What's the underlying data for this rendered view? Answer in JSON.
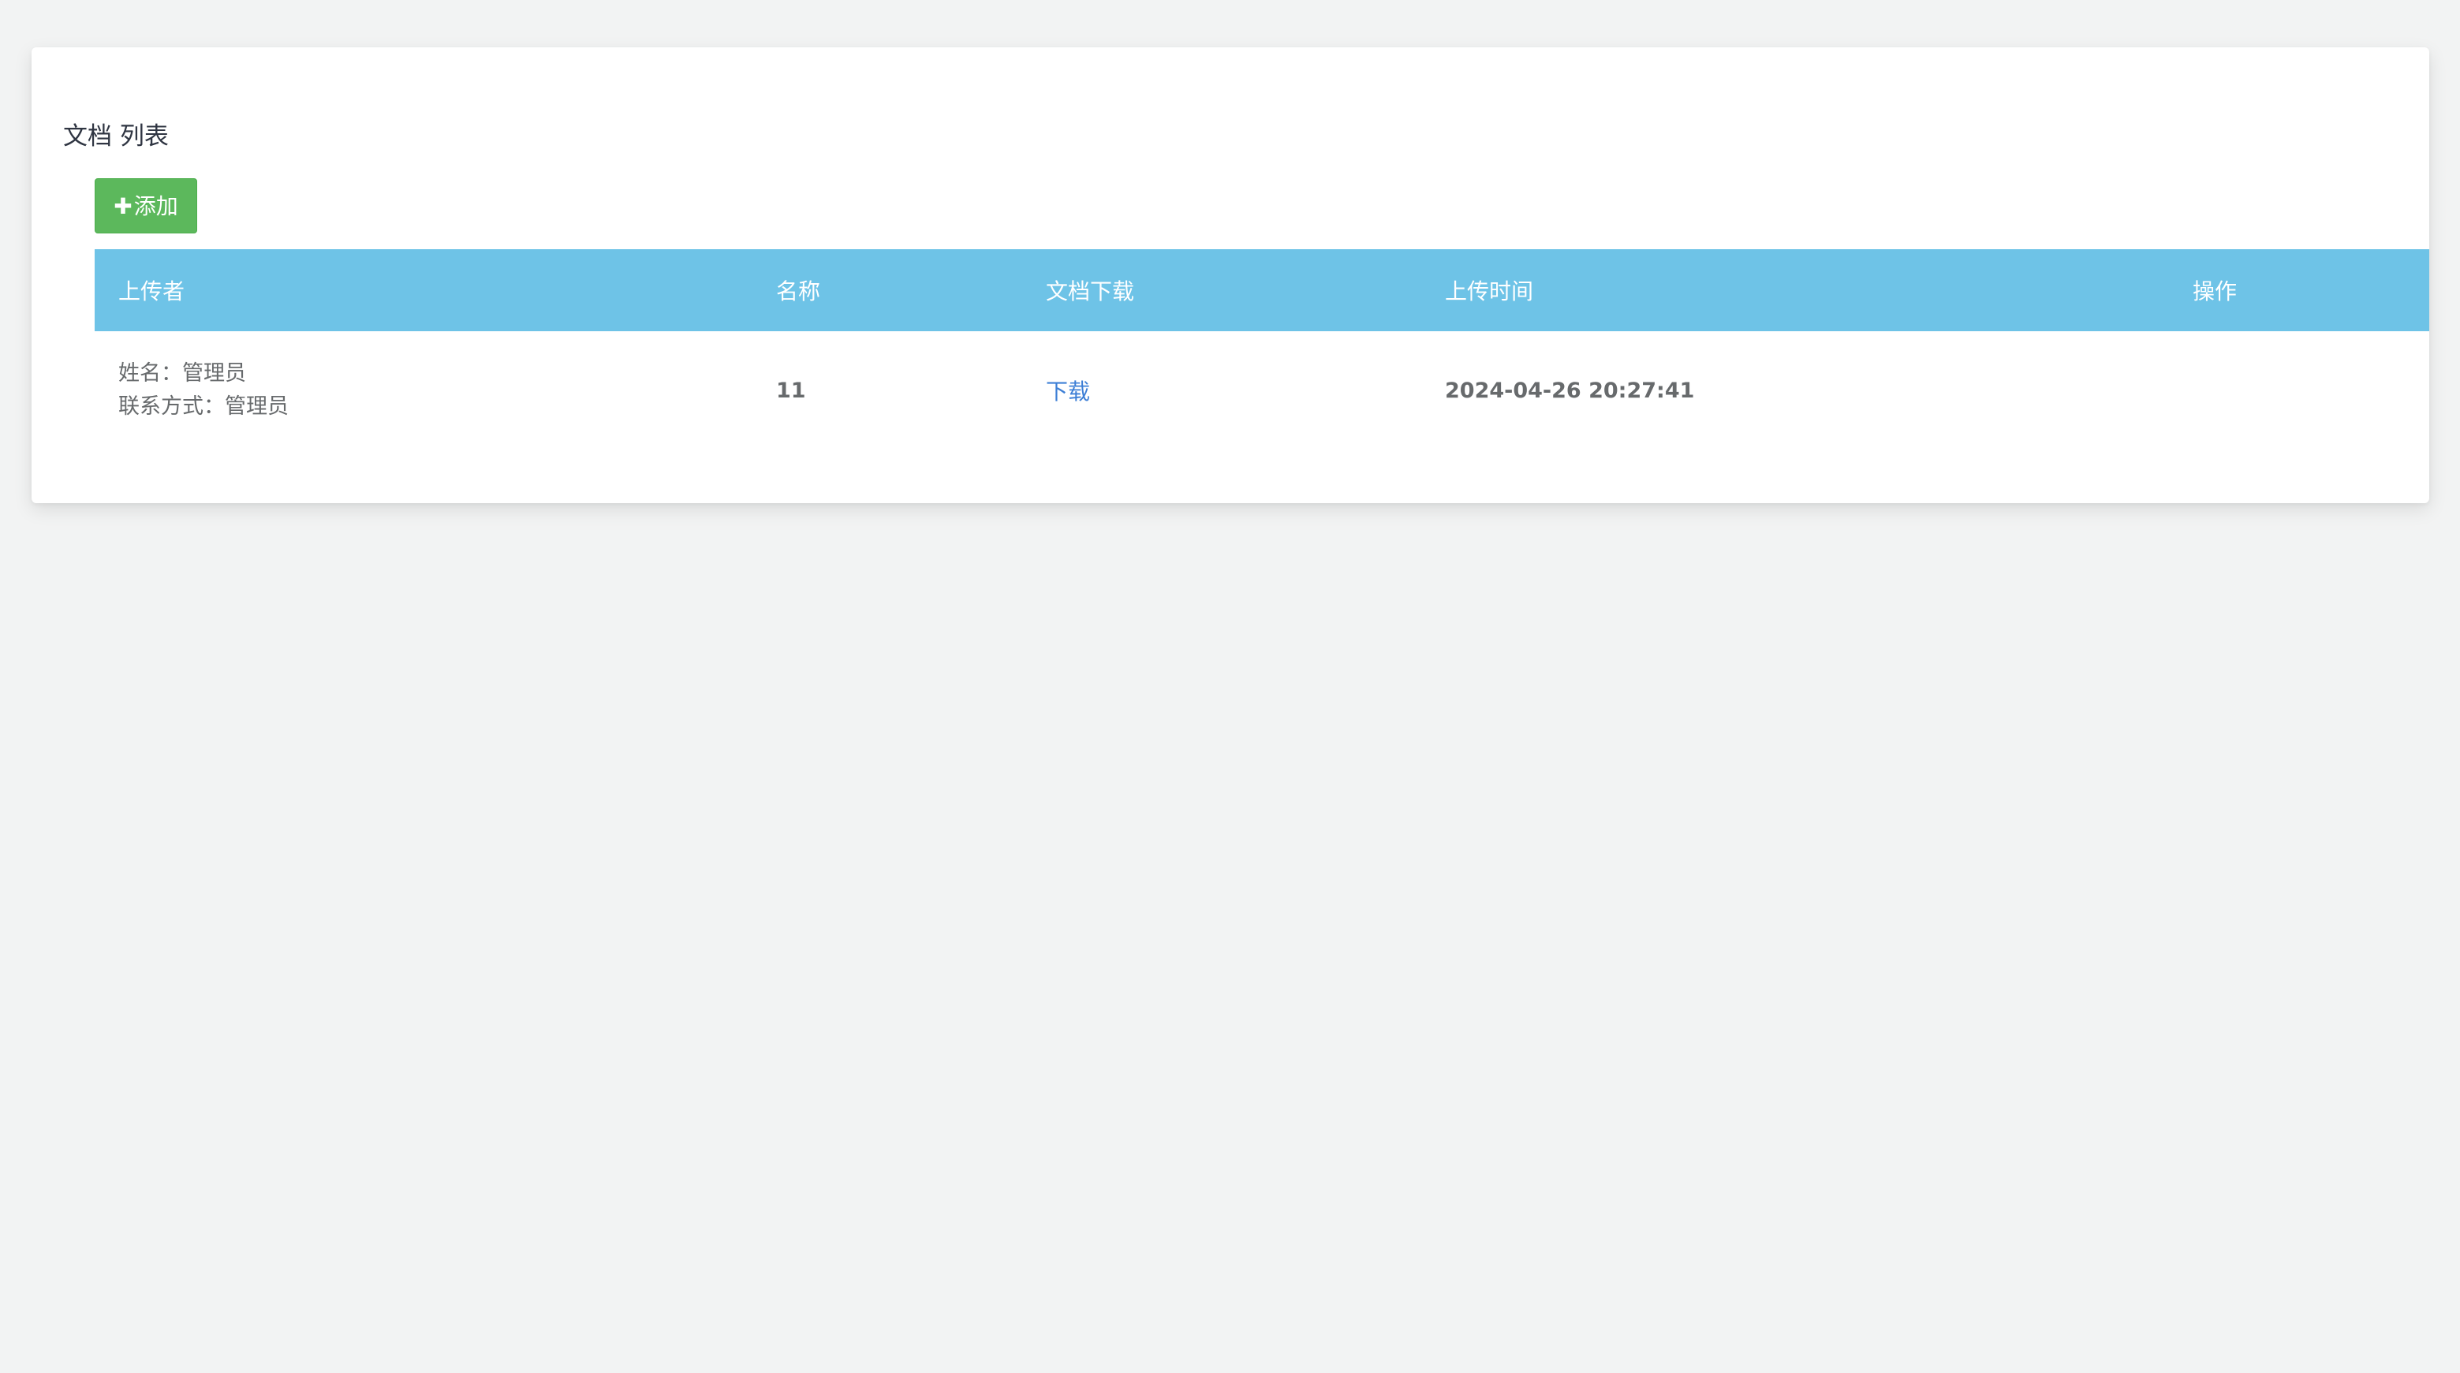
{
  "page": {
    "title": "文档 列表"
  },
  "toolbar": {
    "add_icon": "plus-icon",
    "add_label": "添加"
  },
  "table": {
    "columns": [
      "上传者",
      "名称",
      "文档下载",
      "上传时间",
      "操作"
    ],
    "rows": [
      {
        "uploader_name": "姓名：管理员",
        "uploader_contact": "联系方式：管理员",
        "name": "11",
        "download_label": "下载",
        "upload_time": "2024-04-26 20:27:41",
        "actions": ""
      }
    ]
  },
  "colors": {
    "header_bg": "#6ec3e7",
    "add_button": "#5cb85c",
    "link": "#3d7fd6",
    "page_bg": "#f2f3f3"
  }
}
